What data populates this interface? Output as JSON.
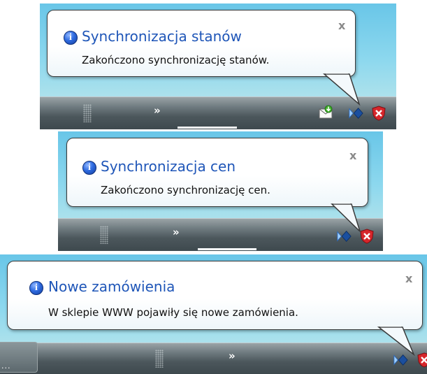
{
  "notifications": [
    {
      "title": "Synchronizacja stanów",
      "message": "Zakończono synchronizację stanów.",
      "close_glyph": "x",
      "overflow_chevron": "»",
      "tray_icons": [
        "mail-download-icon",
        "app-arrow-icon",
        "security-shield-icon"
      ]
    },
    {
      "title": "Synchronizacja cen",
      "message": "Zakończono synchronizację cen.",
      "close_glyph": "x",
      "overflow_chevron": "»",
      "tray_icons": [
        "app-arrow-icon",
        "security-shield-icon"
      ]
    },
    {
      "title": "Nowe zamówienia",
      "message": "W sklepie WWW pojawiły się nowe zamówienia.",
      "close_glyph": "x",
      "overflow_chevron": "»",
      "taskbar_button_text": "...",
      "tray_icons": [
        "app-arrow-icon",
        "security-shield-icon"
      ]
    }
  ],
  "colors": {
    "title_blue": "#1f56b8",
    "taskbar_dark": "#3e494e",
    "desktop_blue": "#69c6e8",
    "shield_red": "#d6262b"
  }
}
